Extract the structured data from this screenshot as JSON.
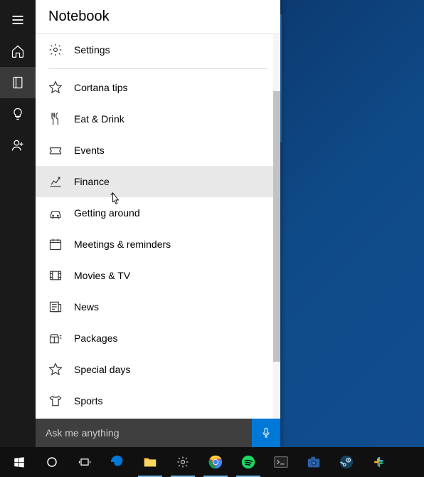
{
  "panel": {
    "title": "Notebook",
    "items": [
      {
        "icon": "gear-icon",
        "label": "Settings"
      },
      {
        "divider": true
      },
      {
        "icon": "star-outline-icon",
        "label": "Cortana tips"
      },
      {
        "icon": "cutlery-icon",
        "label": "Eat & Drink"
      },
      {
        "icon": "ticket-icon",
        "label": "Events"
      },
      {
        "icon": "stocks-icon",
        "label": "Finance",
        "hovered": true
      },
      {
        "icon": "car-icon",
        "label": "Getting around"
      },
      {
        "icon": "calendar-clock-icon",
        "label": "Meetings & reminders"
      },
      {
        "icon": "film-icon",
        "label": "Movies & TV"
      },
      {
        "icon": "newspaper-icon",
        "label": "News"
      },
      {
        "icon": "package-icon",
        "label": "Packages"
      },
      {
        "icon": "star-outline-icon",
        "label": "Special days"
      },
      {
        "icon": "tshirt-icon",
        "label": "Sports"
      }
    ],
    "search_placeholder": "Ask me anything"
  },
  "rail": [
    {
      "icon": "hamburger-icon"
    },
    {
      "icon": "home-icon"
    },
    {
      "icon": "notebook-icon",
      "active": true
    },
    {
      "icon": "lightbulb-icon"
    },
    {
      "icon": "person-add-icon"
    }
  ],
  "taskbar": [
    {
      "name": "start",
      "icon": "windows-icon"
    },
    {
      "name": "cortana",
      "icon": "cortana-ring-icon"
    },
    {
      "name": "task-view",
      "icon": "task-view-icon"
    },
    {
      "name": "edge",
      "icon": "edge-icon"
    },
    {
      "name": "file-explorer",
      "icon": "folder-icon",
      "active": true
    },
    {
      "name": "settings",
      "icon": "gear-icon",
      "active": true
    },
    {
      "name": "chrome",
      "icon": "chrome-icon",
      "active": true
    },
    {
      "name": "spotify",
      "icon": "spotify-icon",
      "active": true
    },
    {
      "name": "terminal",
      "icon": "terminal-icon"
    },
    {
      "name": "camera",
      "icon": "camera-icon"
    },
    {
      "name": "steam",
      "icon": "steam-icon"
    },
    {
      "name": "slack",
      "icon": "slack-icon"
    }
  ]
}
